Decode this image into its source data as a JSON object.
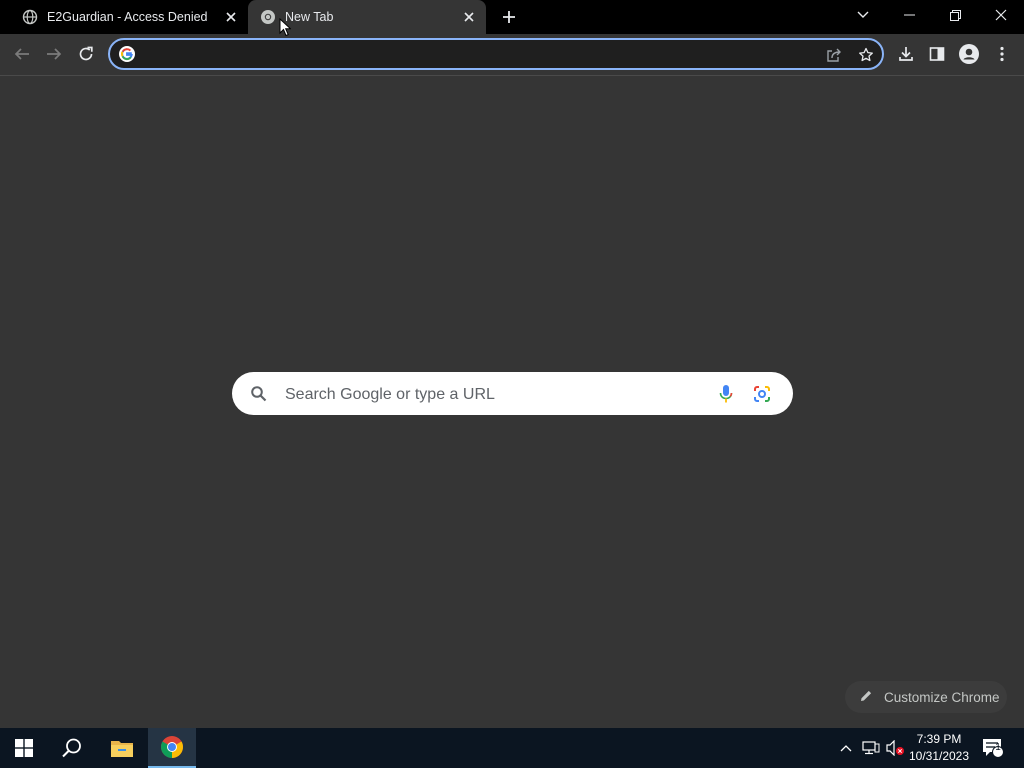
{
  "tabs": [
    {
      "title": "E2Guardian - Access Denied",
      "icon": "globe-icon",
      "active": false
    },
    {
      "title": "New Tab",
      "icon": "chrome-icon",
      "active": true
    }
  ],
  "omnibox": {
    "value": "",
    "icon": "google-g-icon"
  },
  "ntp": {
    "search_placeholder": "Search Google or type a URL",
    "customize_label": "Customize Chrome"
  },
  "taskbar": {
    "time": "7:39 PM",
    "date": "10/31/2023",
    "notification_count": "1"
  },
  "colors": {
    "tabstrip": "#000000",
    "page_background": "#353535",
    "omnibox_focus": "#8ab4f8",
    "taskbar": "#0b1521"
  }
}
